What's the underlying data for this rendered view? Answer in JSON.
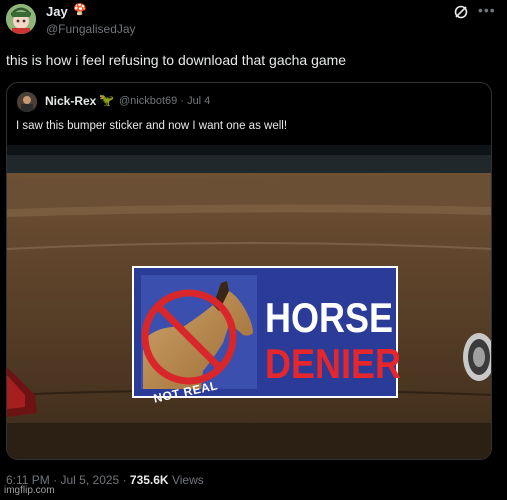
{
  "post": {
    "author_name": "Jay",
    "author_emoji": "🍄",
    "author_handle": "@FungalisedJay",
    "text": "this is how i feel refusing to download that gacha game",
    "time": "6:11 PM",
    "date": "Jul 5, 2025",
    "views_count": "735.6K",
    "views_label": "Views"
  },
  "quote": {
    "author_name": "Nick-Rex",
    "author_emoji": "🦖",
    "author_handle": "@nickbot69",
    "date": "Jul 4",
    "text": "I saw this bumper sticker and now I want one as well!"
  },
  "sticker": {
    "badge_text": "NOT REAL",
    "line1": "HORSE",
    "line2": "DENIER",
    "colors": {
      "background": "#2a3b98",
      "line1": "#ffffff",
      "line2": "#e6262d",
      "ban_ring": "#d8262b"
    }
  },
  "icons": {
    "grok": "grok-icon",
    "more": "more-icon"
  },
  "watermark": "imgflip.com"
}
